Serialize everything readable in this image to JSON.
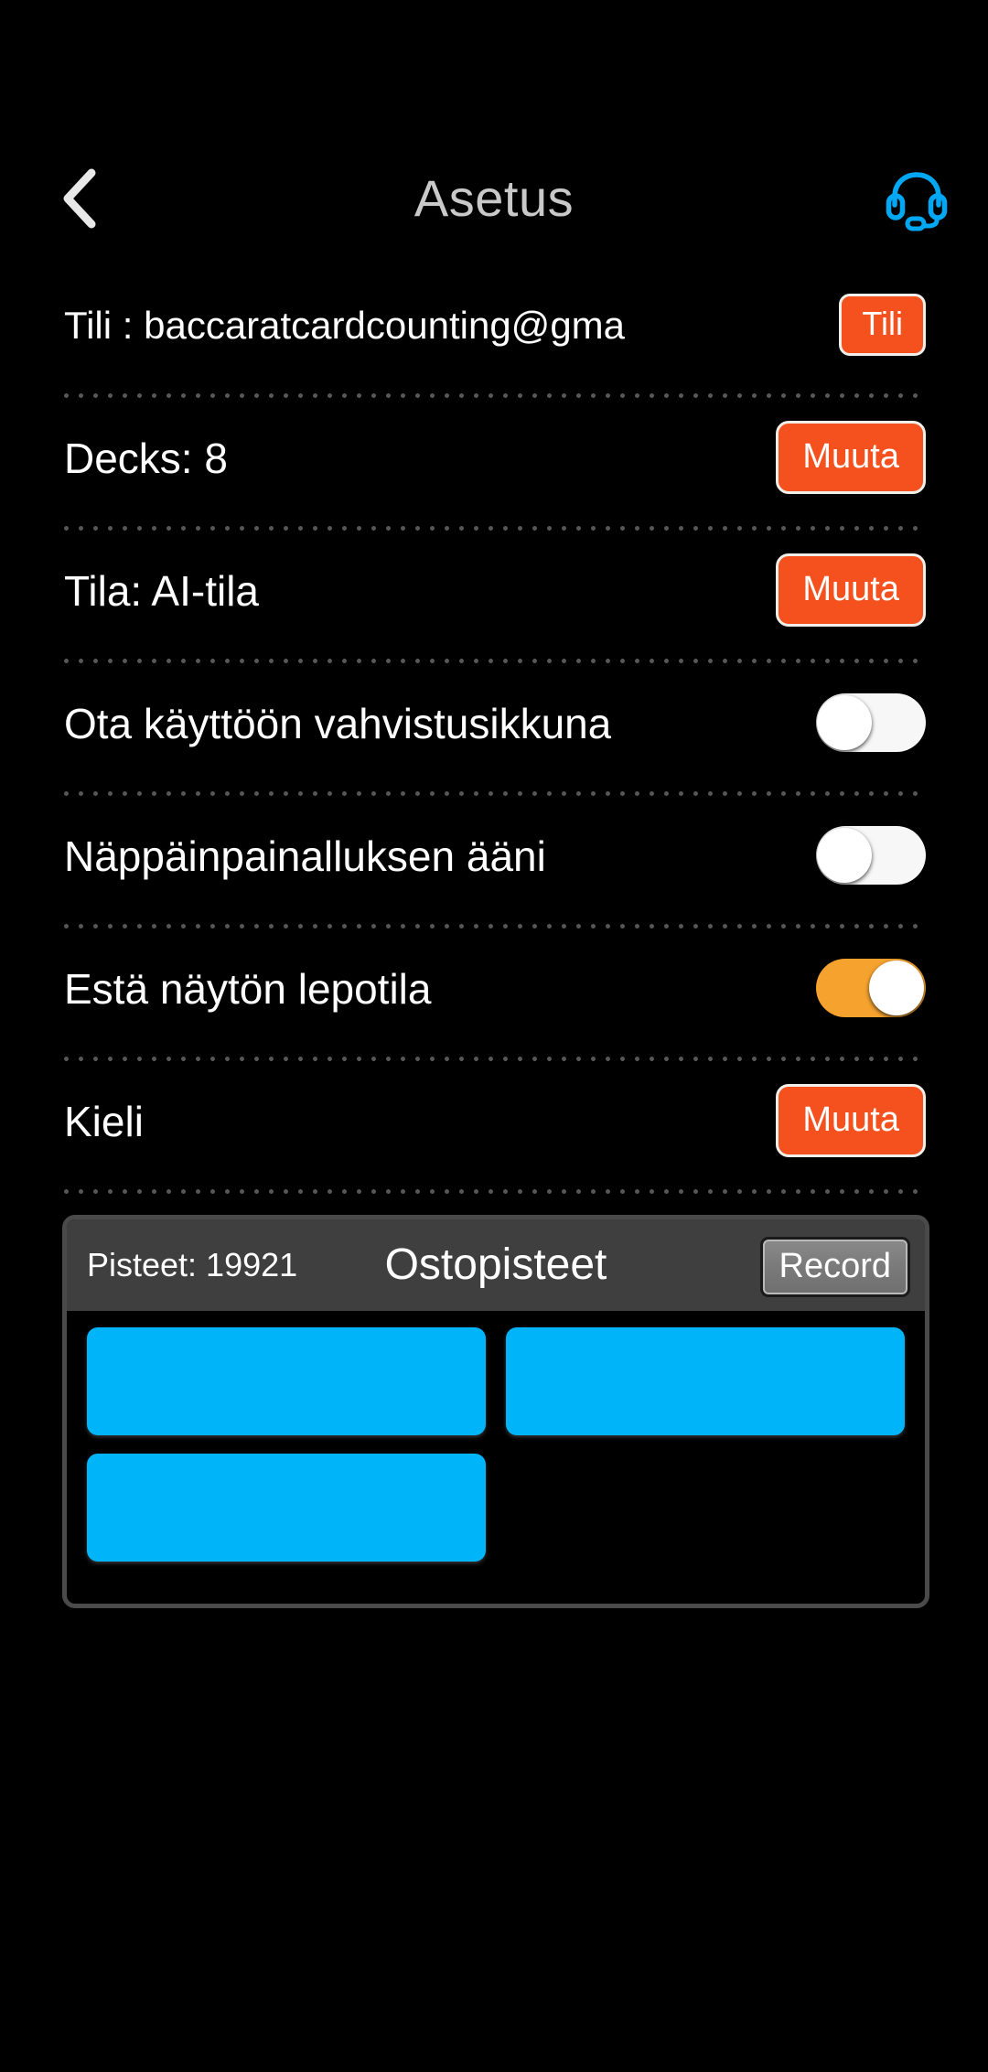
{
  "header": {
    "title": "Asetus",
    "back_icon": "chevron-left-icon",
    "support_icon": "headset-icon"
  },
  "settings": {
    "rows": [
      {
        "label": "Tili : baccaratcardcounting@gma",
        "control": "button",
        "button_label": "Tili"
      },
      {
        "label": "Decks: 8",
        "control": "button",
        "button_label": "Muuta"
      },
      {
        "label": "Tila: AI-tila",
        "control": "button",
        "button_label": "Muuta"
      },
      {
        "label": "Ota käyttöön vahvistusikkuna",
        "control": "toggle",
        "toggle_state": "off"
      },
      {
        "label": "Näppäinpainalluksen ääni",
        "control": "toggle",
        "toggle_state": "off"
      },
      {
        "label": "Estä näytön lepotila",
        "control": "toggle",
        "toggle_state": "on"
      },
      {
        "label": "Kieli",
        "control": "button",
        "button_label": "Muuta"
      }
    ]
  },
  "points_card": {
    "score_label": "Pisteet: 19921",
    "title": "Ostopisteet",
    "record_label": "Record",
    "tiles": [
      {
        "label": ""
      },
      {
        "label": ""
      },
      {
        "label": ""
      }
    ]
  },
  "colors": {
    "background": "#000000",
    "accent_orange": "#f4511e",
    "toggle_on": "#f5a32e",
    "tile_blue": "#00b4fa",
    "support_icon": "#00a8f3",
    "card_header": "#3f3f3f",
    "divider_dot": "#575757",
    "title_text": "#c9c9c9"
  }
}
